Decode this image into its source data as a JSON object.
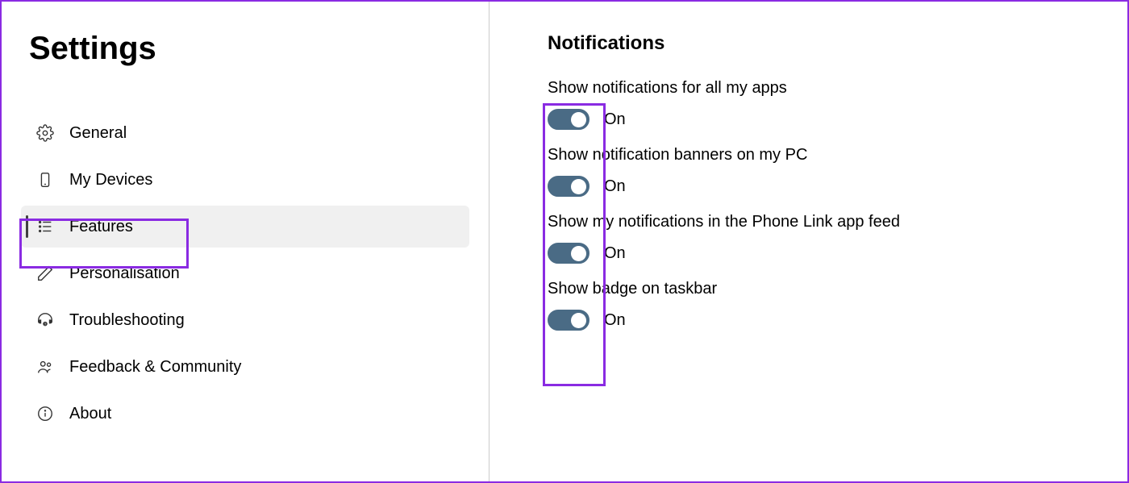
{
  "page_title": "Settings",
  "sidebar": {
    "items": [
      {
        "label": "General",
        "icon": "gear",
        "active": false
      },
      {
        "label": "My Devices",
        "icon": "phone",
        "active": false
      },
      {
        "label": "Features",
        "icon": "list",
        "active": true
      },
      {
        "label": "Personalisation",
        "icon": "pen",
        "active": false
      },
      {
        "label": "Troubleshooting",
        "icon": "headset-help",
        "active": false
      },
      {
        "label": "Feedback & Community",
        "icon": "people",
        "active": false
      },
      {
        "label": "About",
        "icon": "info",
        "active": false
      }
    ]
  },
  "main": {
    "section_title": "Notifications",
    "settings": [
      {
        "label": "Show notifications for all my apps",
        "state": "On",
        "on": true
      },
      {
        "label": "Show notification banners on my PC",
        "state": "On",
        "on": true
      },
      {
        "label": "Show my notifications in the Phone Link app feed",
        "state": "On",
        "on": true
      },
      {
        "label": "Show badge on taskbar",
        "state": "On",
        "on": true
      }
    ]
  },
  "annotation_color": "#8a2be2"
}
